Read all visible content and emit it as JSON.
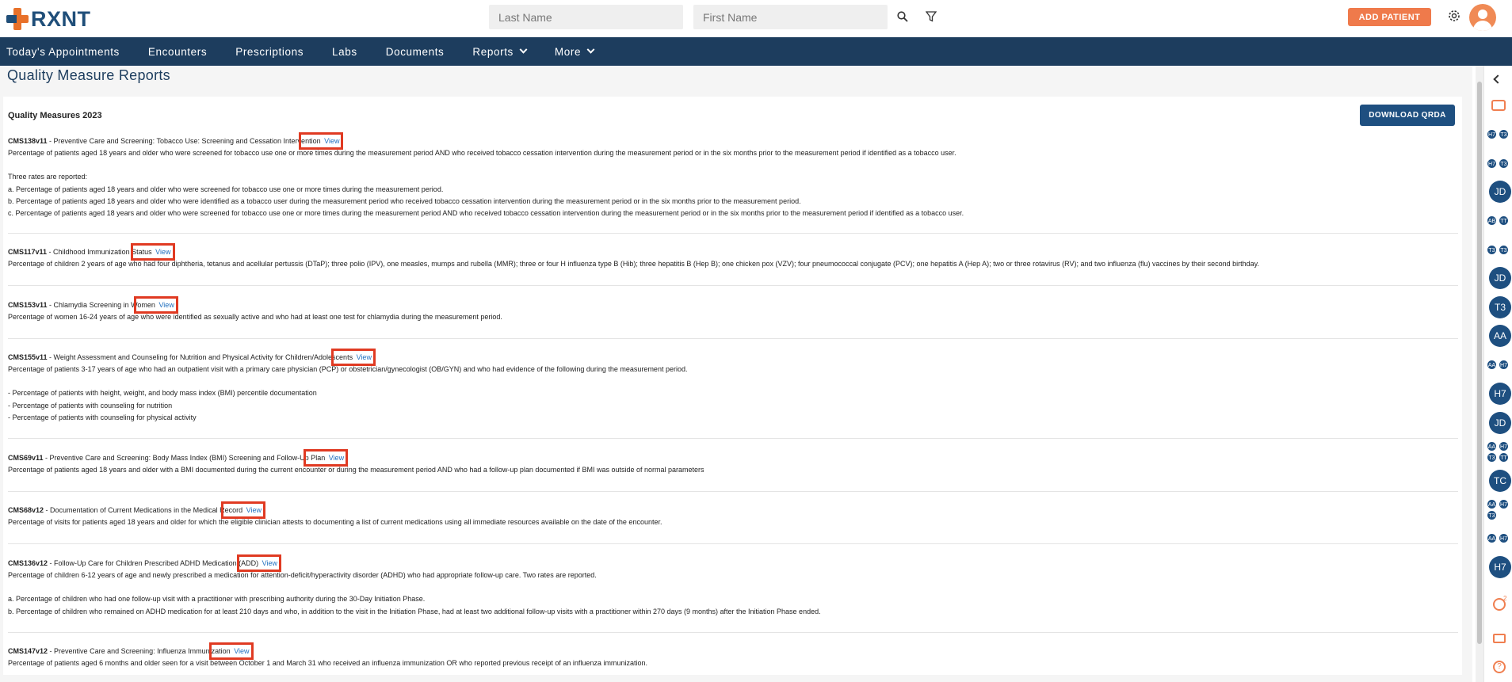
{
  "header": {
    "brand": "RXNT",
    "last_name_placeholder": "Last Name",
    "first_name_placeholder": "First Name",
    "add_patient_label": "ADD PATIENT"
  },
  "nav": {
    "items": [
      {
        "label": "Today's Appointments"
      },
      {
        "label": "Encounters"
      },
      {
        "label": "Prescriptions"
      },
      {
        "label": "Labs"
      },
      {
        "label": "Documents"
      },
      {
        "label": "Reports"
      },
      {
        "label": "More"
      }
    ]
  },
  "page": {
    "title": "Quality Measure Reports",
    "section_title": "Quality Measures 2023",
    "download_label": "DOWNLOAD QRDA",
    "view_label": "View"
  },
  "measures": [
    {
      "code": "CMS138v11",
      "title": " - Preventive Care and Screening: Tobacco Use: Screening and Cessation Intervention",
      "lines": [
        "Percentage of patients aged 18 years and older who were screened for tobacco use one or more times during the measurement period AND who received tobacco cessation intervention during the measurement period or in the six months prior to the measurement period if identified as a tobacco user.",
        "",
        "Three rates are reported:",
        "a. Percentage of patients aged 18 years and older who were screened for tobacco use one or more times during the measurement period.",
        "b. Percentage of patients aged 18 years and older who were identified as a tobacco user during the measurement period who received tobacco cessation intervention during the measurement period or in the six months prior to the measurement period.",
        "c. Percentage of patients aged 18 years and older who were screened for tobacco use one or more times during the measurement period AND who received tobacco cessation intervention during the measurement period or in the six months prior to the measurement period if identified as a tobacco user."
      ]
    },
    {
      "code": "CMS117v11",
      "title": " - Childhood Immunization Status",
      "lines": [
        "Percentage of children 2 years of age who had four diphtheria, tetanus and acellular pertussis (DTaP); three polio (IPV), one measles, mumps and rubella (MMR); three or four H influenza type B (Hib); three hepatitis B (Hep B); one chicken pox (VZV); four pneumococcal conjugate (PCV); one hepatitis A (Hep A); two or three rotavirus (RV); and two influenza (flu) vaccines by their second birthday."
      ]
    },
    {
      "code": "CMS153v11",
      "title": " - Chlamydia Screening in Women",
      "lines": [
        "Percentage of women 16-24 years of age who were identified as sexually active and who had at least one test for chlamydia during the measurement period."
      ]
    },
    {
      "code": "CMS155v11",
      "title": " - Weight Assessment and Counseling for Nutrition and Physical Activity for Children/Adolescents",
      "lines": [
        "Percentage of patients 3-17 years of age who had an outpatient visit with a primary care physician (PCP) or obstetrician/gynecologist (OB/GYN) and who had evidence of the following during the measurement period.",
        "",
        "- Percentage of patients with height, weight, and body mass index (BMI) percentile documentation",
        "- Percentage of patients with counseling for nutrition",
        "- Percentage of patients with counseling for physical activity"
      ]
    },
    {
      "code": "CMS69v11",
      "title": " - Preventive Care and Screening: Body Mass Index (BMI) Screening and Follow-Up Plan",
      "lines": [
        "Percentage of patients aged 18 years and older with a BMI documented during the current encounter or during the measurement period AND who had a follow-up plan documented if BMI was outside of normal parameters"
      ]
    },
    {
      "code": "CMS68v12",
      "title": " - Documentation of Current Medications in the Medical Record",
      "lines": [
        "Percentage of visits for patients aged 18 years and older for which the eligible clinician attests to documenting a list of current medications using all immediate resources available on the date of the encounter."
      ]
    },
    {
      "code": "CMS136v12",
      "title": " - Follow-Up Care for Children Prescribed ADHD Medication (ADD)",
      "lines": [
        "Percentage of children 6-12 years of age and newly prescribed a medication for attention-deficit/hyperactivity disorder (ADHD) who had appropriate follow-up care. Two rates are reported.",
        "",
        "a. Percentage of children who had one follow-up visit with a practitioner with prescribing authority during the 30-Day Initiation Phase.",
        "b. Percentage of children who remained on ADHD medication for at least 210 days and who, in addition to the visit in the Initiation Phase, had at least two additional follow-up visits with a practitioner within 270 days (9 months) after the Initiation Phase ended."
      ]
    },
    {
      "code": "CMS147v12",
      "title": " - Preventive Care and Screening: Influenza Immunization",
      "lines": [
        "Percentage of patients aged 6 months and older seen for a visit between October 1 and March 31 who received an influenza immunization OR who reported previous receipt of an influenza immunization."
      ]
    }
  ],
  "sidebar": {
    "avatars_small": [
      "H7",
      "T3",
      "H7",
      "T3",
      "AB",
      "TT",
      "T3",
      "T3",
      "AA",
      "H7",
      "AA",
      "H7",
      "T3",
      "TT",
      "AA",
      "H7",
      "T3",
      "AA",
      "H7"
    ],
    "avatars_large": [
      "JD",
      "JD",
      "T3",
      "AA",
      "H7",
      "JD",
      "TC",
      "H7"
    ],
    "task_badge": "2",
    "help_glyph": "?"
  },
  "colors": {
    "brand_blue": "#1d3d5e",
    "accent_orange": "#ef7a4b",
    "link_blue": "#1f6fbf",
    "highlight_red": "#e03a22"
  }
}
